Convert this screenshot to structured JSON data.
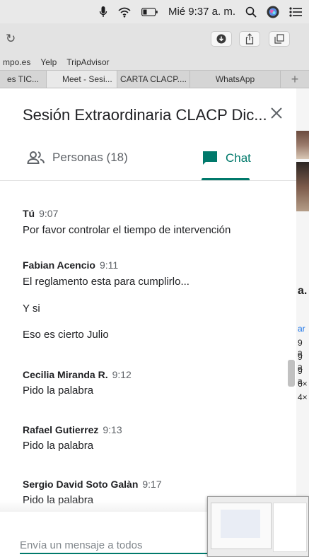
{
  "menubar": {
    "datetime": "Mié 9:37 a. m."
  },
  "bookmarks": [
    "mpo.es",
    "Yelp",
    "TripAdvisor"
  ],
  "tabs": [
    "es TIC...",
    "Meet - Sesi...",
    "CARTA CLACP....",
    "WhatsApp",
    "+"
  ],
  "panel": {
    "title": "Sesión Extraordinaria CLACP Dic...",
    "people_tab_label": "Personas (18)",
    "chat_tab_label": "Chat",
    "accent_color": "#00796b"
  },
  "messages": [
    {
      "sender": "Tú",
      "time": "9:07",
      "texts": [
        "Por favor controlar el tiempo de intervención"
      ]
    },
    {
      "sender": "Fabian Acencio",
      "time": "9:11",
      "texts": [
        "El reglamento esta para cumplirlo...",
        "Y si",
        "Eso es cierto Julio"
      ]
    },
    {
      "sender": "Cecilia Miranda R.",
      "time": "9:12",
      "texts": [
        "Pido la palabra"
      ]
    },
    {
      "sender": "Rafael Gutierrez",
      "time": "9:13",
      "texts": [
        "Pido la palabra"
      ]
    },
    {
      "sender": "Sergio David Soto Galàn",
      "time": "9:17",
      "texts": [
        "Pido la palabra"
      ]
    }
  ],
  "send": {
    "placeholder": "Envía un mensaje a todos"
  },
  "background_page": {
    "letters": [
      "a.",
      "ar",
      "9 a",
      "9 a",
      "9 a",
      "6×",
      "4×"
    ]
  }
}
